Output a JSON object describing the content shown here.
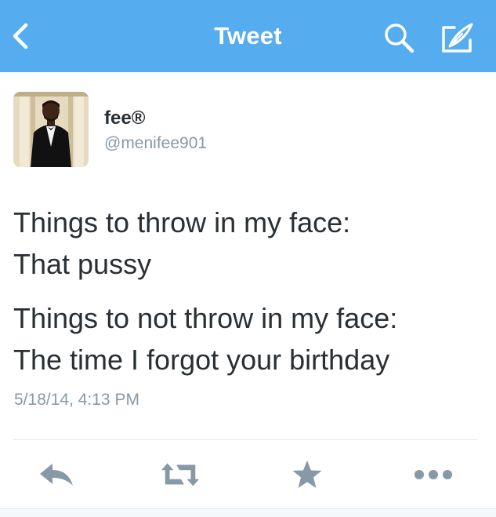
{
  "navbar": {
    "title": "Tweet",
    "back_icon": "chevron-left-icon",
    "search_icon": "search-icon",
    "compose_icon": "compose-icon",
    "background_color": "#55acee"
  },
  "tweet": {
    "user": {
      "display_name": "fee®",
      "handle": "@menifee901"
    },
    "lines": [
      "Things to throw in my face:",
      "That pussy",
      "Things to not throw in my face:",
      "The time I forgot your birthday"
    ],
    "timestamp": "5/18/14, 4:13 PM"
  },
  "actions": {
    "icons": [
      "reply-icon",
      "retweet-icon",
      "favorite-star-icon",
      "more-dots-icon"
    ],
    "icon_color": "#8899a6"
  }
}
